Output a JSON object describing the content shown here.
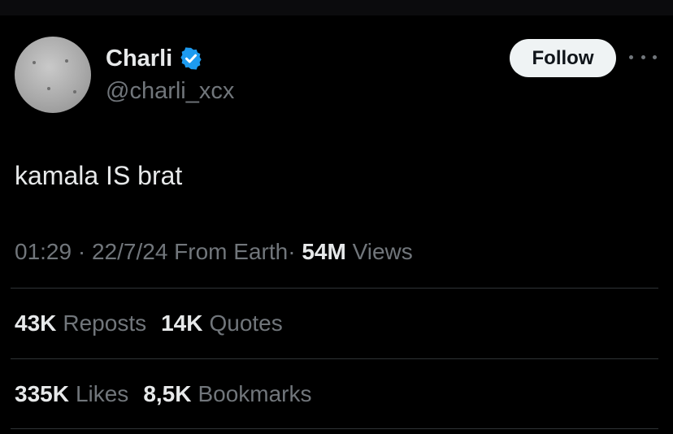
{
  "author": {
    "display_name": "Charli",
    "handle": "@charli_xcx",
    "verified": true,
    "verified_color": "#1d9bf0"
  },
  "actions": {
    "follow_label": "Follow",
    "more_icon": "ellipsis-icon"
  },
  "tweet": {
    "text": "kamala IS brat"
  },
  "meta": {
    "time": "01:29",
    "date": "22/7/24",
    "source": "From Earth",
    "separator": "·",
    "views_count": "54M",
    "views_label": "Views"
  },
  "stats": {
    "reposts_count": "43K",
    "reposts_label": "Reposts",
    "quotes_count": "14K",
    "quotes_label": "Quotes",
    "likes_count": "335K",
    "likes_label": "Likes",
    "bookmarks_count": "8,5K",
    "bookmarks_label": "Bookmarks"
  },
  "colors": {
    "background": "#000000",
    "primary_text": "#e7e9ea",
    "secondary_text": "#71767b",
    "divider": "#2f3336",
    "follow_button_bg": "#eff3f4"
  }
}
